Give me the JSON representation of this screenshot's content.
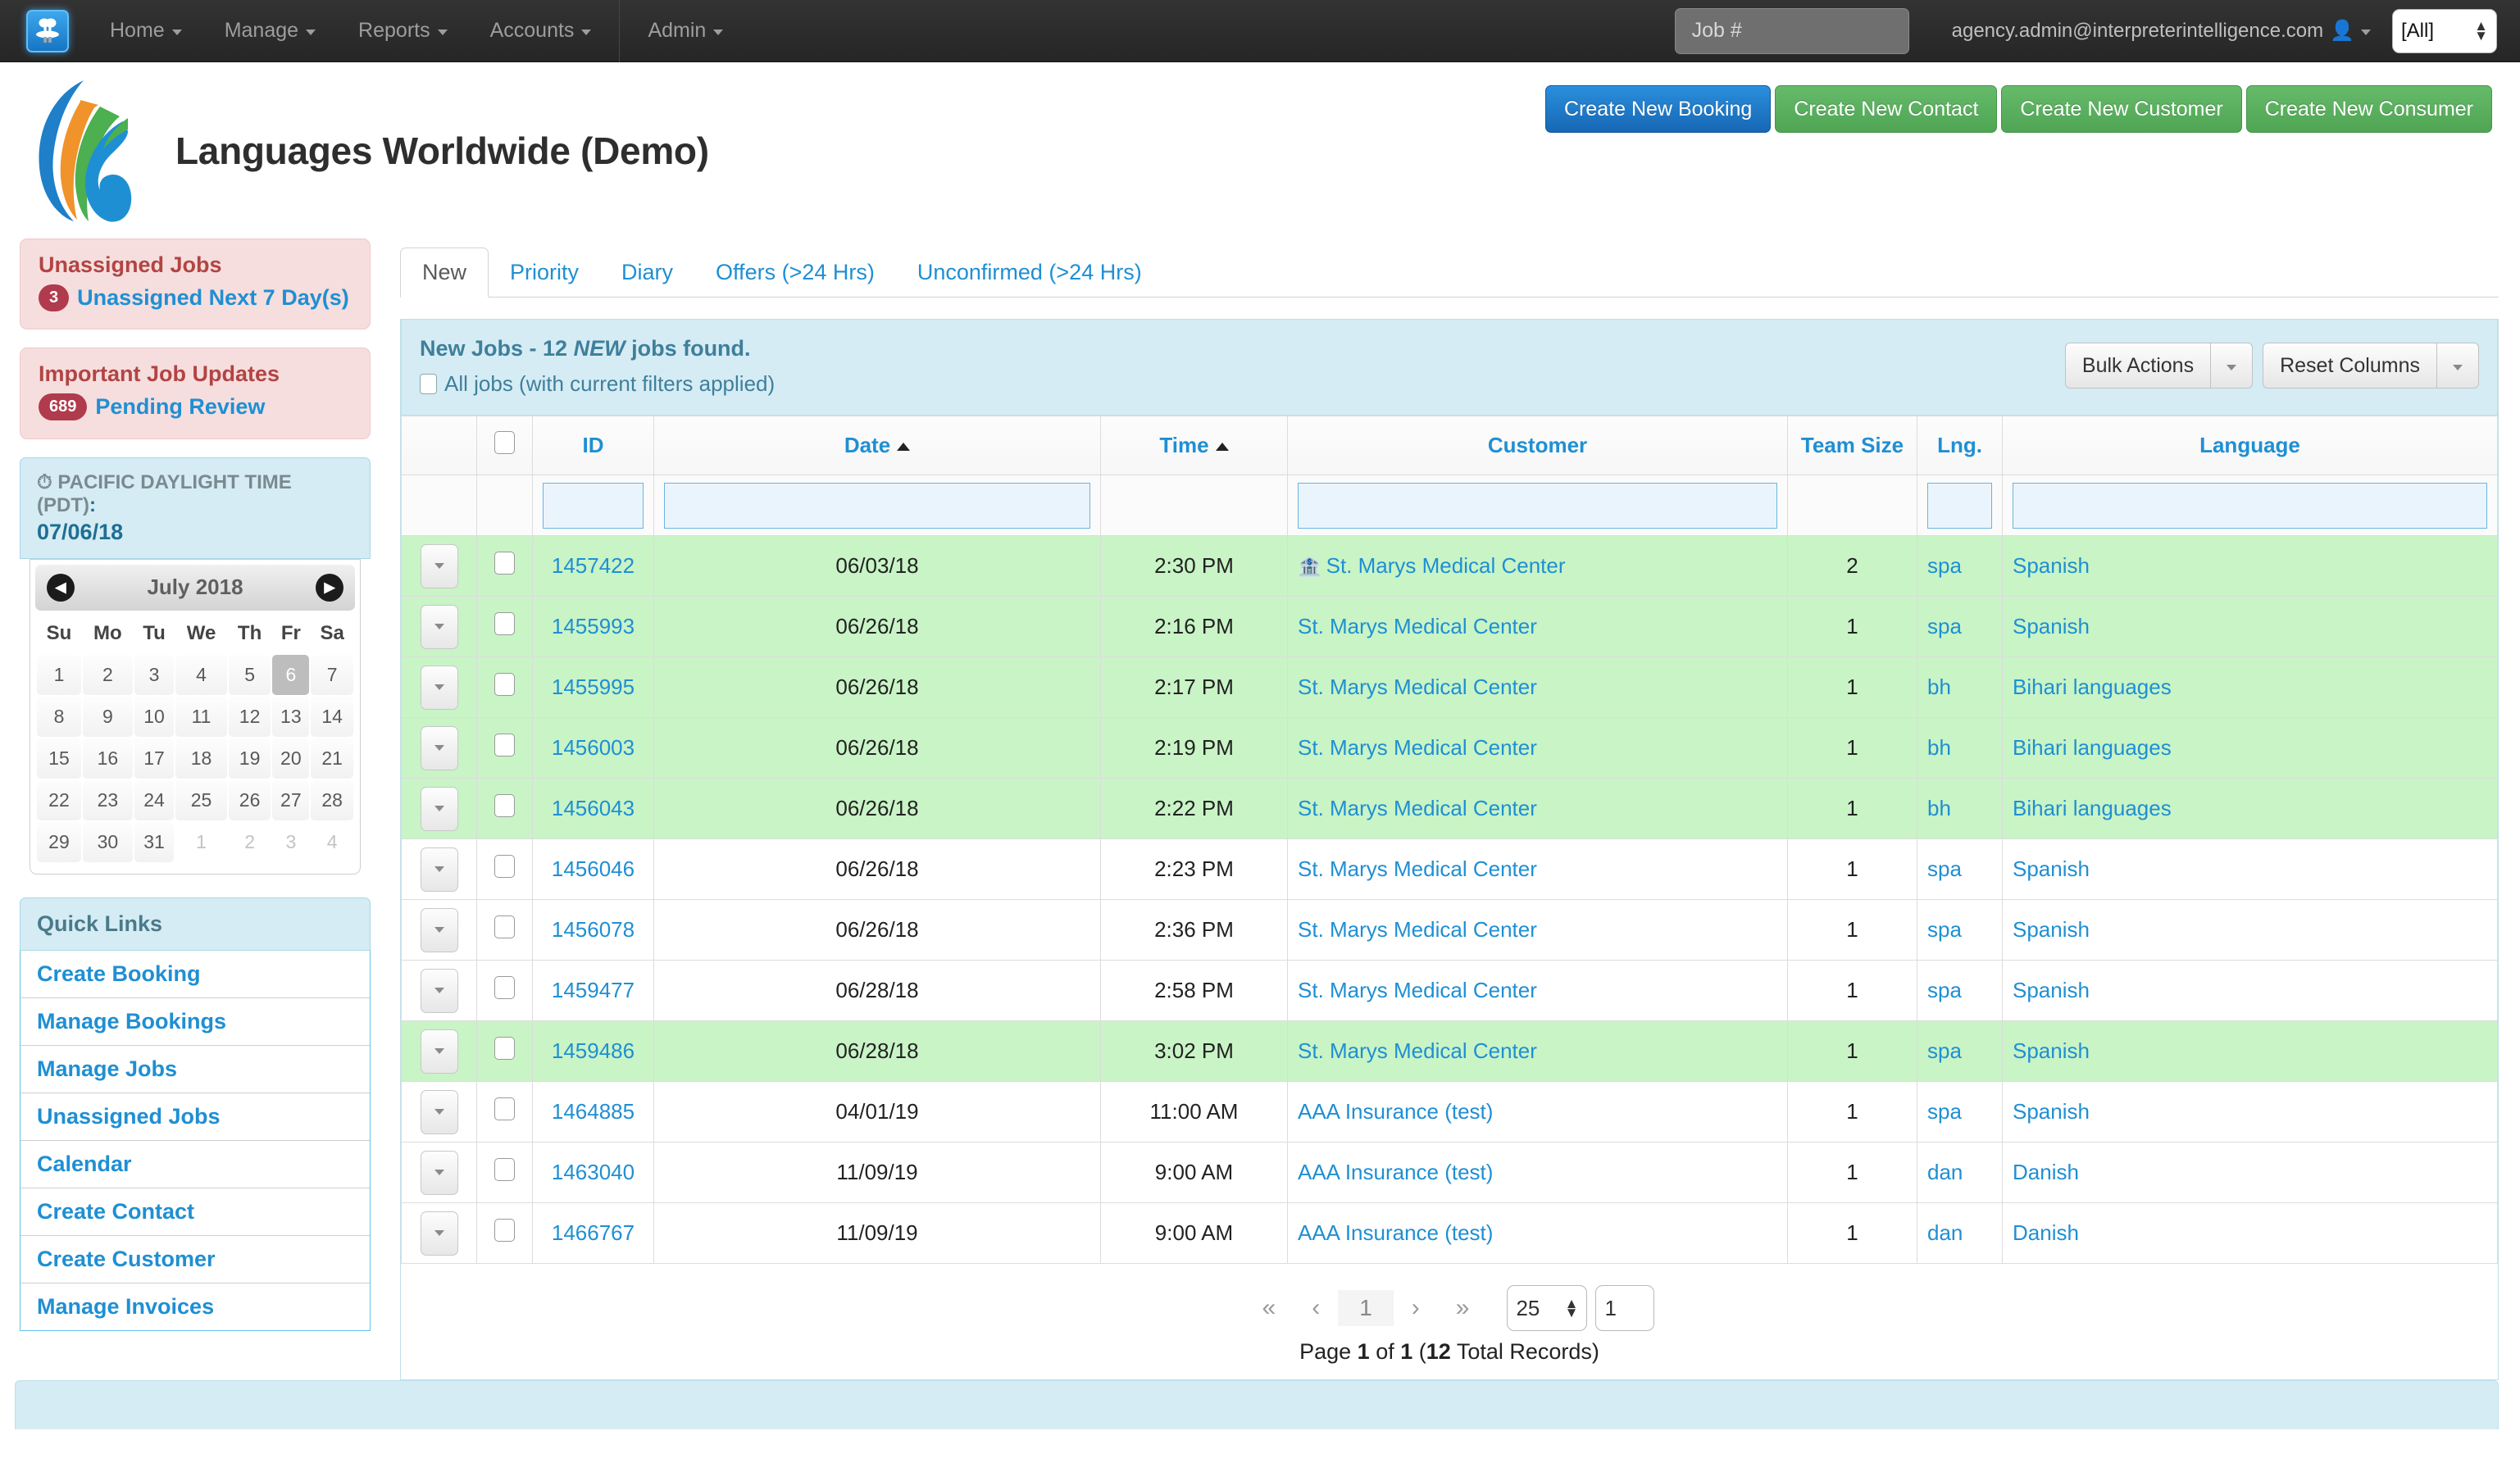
{
  "topnav": {
    "logo_icon": "app-logo-icon",
    "items": [
      {
        "label": "Home",
        "caret": true
      },
      {
        "label": "Manage",
        "caret": true
      },
      {
        "label": "Reports",
        "caret": true
      },
      {
        "label": "Accounts",
        "caret": true
      }
    ],
    "admin": {
      "label": "Admin",
      "caret": true
    },
    "job_search_placeholder": "Job #",
    "job_search_value": "",
    "user_email": "agency.admin@interpreterintelligence.com",
    "user_icon": "person-icon",
    "scope_select_value": "[All]"
  },
  "header": {
    "logo_icon": "company-swoosh-logo",
    "title": "Languages Worldwide (Demo)",
    "buttons": [
      {
        "label": "Create New Booking",
        "style": "blue"
      },
      {
        "label": "Create New Contact",
        "style": "green"
      },
      {
        "label": "Create New Customer",
        "style": "green"
      },
      {
        "label": "Create New Consumer",
        "style": "green"
      }
    ]
  },
  "sidebar": {
    "alerts": [
      {
        "title": "Unassigned Jobs",
        "badge": "3",
        "link": "Unassigned Next 7 Day(s)"
      },
      {
        "title": "Important Job Updates",
        "badge": "689",
        "link": "Pending Review"
      }
    ],
    "timezone": {
      "clock_icon": "clock-icon",
      "label": "PACIFIC DAYLIGHT TIME (PDT)",
      "date": "07/06/18"
    },
    "calendar": {
      "month_label": "July 2018",
      "prev_icon": "chevron-left-icon",
      "next_icon": "chevron-right-icon",
      "weekdays": [
        "Su",
        "Mo",
        "Tu",
        "We",
        "Th",
        "Fr",
        "Sa"
      ],
      "today": 6,
      "weeks": [
        [
          {
            "d": "1"
          },
          {
            "d": "2"
          },
          {
            "d": "3"
          },
          {
            "d": "4"
          },
          {
            "d": "5"
          },
          {
            "d": "6",
            "today": true
          },
          {
            "d": "7"
          }
        ],
        [
          {
            "d": "8"
          },
          {
            "d": "9"
          },
          {
            "d": "10"
          },
          {
            "d": "11"
          },
          {
            "d": "12"
          },
          {
            "d": "13"
          },
          {
            "d": "14"
          }
        ],
        [
          {
            "d": "15"
          },
          {
            "d": "16"
          },
          {
            "d": "17"
          },
          {
            "d": "18"
          },
          {
            "d": "19"
          },
          {
            "d": "20"
          },
          {
            "d": "21"
          }
        ],
        [
          {
            "d": "22"
          },
          {
            "d": "23"
          },
          {
            "d": "24"
          },
          {
            "d": "25"
          },
          {
            "d": "26"
          },
          {
            "d": "27"
          },
          {
            "d": "28"
          }
        ],
        [
          {
            "d": "29"
          },
          {
            "d": "30"
          },
          {
            "d": "31"
          },
          {
            "d": "1",
            "other": true
          },
          {
            "d": "2",
            "other": true
          },
          {
            "d": "3",
            "other": true
          },
          {
            "d": "4",
            "other": true
          }
        ]
      ]
    },
    "quick_links": {
      "title": "Quick Links",
      "items": [
        "Create Booking",
        "Manage Bookings",
        "Manage Jobs",
        "Unassigned Jobs",
        "Calendar",
        "Create Contact",
        "Create Customer",
        "Manage Invoices"
      ]
    }
  },
  "main": {
    "tabs": [
      {
        "label": "New",
        "active": true
      },
      {
        "label": "Priority",
        "active": false
      },
      {
        "label": "Diary",
        "active": false
      },
      {
        "label": "Offers (>24 Hrs)",
        "active": false
      },
      {
        "label": "Unconfirmed (>24 Hrs)",
        "active": false
      }
    ],
    "panel": {
      "title_pre": "New Jobs - 12 ",
      "title_em": "NEW",
      "title_post": " jobs found.",
      "all_jobs_label": "All jobs (with current filters applied)",
      "all_jobs_checked": false,
      "bulk_actions_label": "Bulk Actions",
      "reset_columns_label": "Reset Columns"
    },
    "table": {
      "columns": [
        {
          "key": "arrow",
          "label": ""
        },
        {
          "key": "check",
          "label": ""
        },
        {
          "key": "id",
          "label": "ID",
          "sort": ""
        },
        {
          "key": "date",
          "label": "Date",
          "sort": "asc"
        },
        {
          "key": "time",
          "label": "Time",
          "sort": "asc"
        },
        {
          "key": "customer",
          "label": "Customer",
          "sort": ""
        },
        {
          "key": "team_size",
          "label": "Team Size",
          "sort": ""
        },
        {
          "key": "lng",
          "label": "Lng.",
          "sort": ""
        },
        {
          "key": "language",
          "label": "Language",
          "sort": ""
        }
      ],
      "filter_values": {
        "id": "",
        "date": "",
        "time": "",
        "customer": "",
        "team_size": "",
        "lng": "",
        "language": ""
      },
      "rows": [
        {
          "id": "1457422",
          "date": "06/03/18",
          "time": "2:30 PM",
          "customer": "St. Marys Medical Center",
          "customer_icon": "building-icon",
          "team_size": "2",
          "lng": "spa",
          "language": "Spanish",
          "highlight": true
        },
        {
          "id": "1455993",
          "date": "06/26/18",
          "time": "2:16 PM",
          "customer": "St. Marys Medical Center",
          "customer_icon": "",
          "team_size": "1",
          "lng": "spa",
          "language": "Spanish",
          "highlight": true
        },
        {
          "id": "1455995",
          "date": "06/26/18",
          "time": "2:17 PM",
          "customer": "St. Marys Medical Center",
          "customer_icon": "",
          "team_size": "1",
          "lng": "bh",
          "language": "Bihari languages",
          "highlight": true
        },
        {
          "id": "1456003",
          "date": "06/26/18",
          "time": "2:19 PM",
          "customer": "St. Marys Medical Center",
          "customer_icon": "",
          "team_size": "1",
          "lng": "bh",
          "language": "Bihari languages",
          "highlight": true
        },
        {
          "id": "1456043",
          "date": "06/26/18",
          "time": "2:22 PM",
          "customer": "St. Marys Medical Center",
          "customer_icon": "",
          "team_size": "1",
          "lng": "bh",
          "language": "Bihari languages",
          "highlight": true
        },
        {
          "id": "1456046",
          "date": "06/26/18",
          "time": "2:23 PM",
          "customer": "St. Marys Medical Center",
          "customer_icon": "",
          "team_size": "1",
          "lng": "spa",
          "language": "Spanish",
          "highlight": false
        },
        {
          "id": "1456078",
          "date": "06/26/18",
          "time": "2:36 PM",
          "customer": "St. Marys Medical Center",
          "customer_icon": "",
          "team_size": "1",
          "lng": "spa",
          "language": "Spanish",
          "highlight": false
        },
        {
          "id": "1459477",
          "date": "06/28/18",
          "time": "2:58 PM",
          "customer": "St. Marys Medical Center",
          "customer_icon": "",
          "team_size": "1",
          "lng": "spa",
          "language": "Spanish",
          "highlight": false
        },
        {
          "id": "1459486",
          "date": "06/28/18",
          "time": "3:02 PM",
          "customer": "St. Marys Medical Center",
          "customer_icon": "",
          "team_size": "1",
          "lng": "spa",
          "language": "Spanish",
          "highlight": true
        },
        {
          "id": "1464885",
          "date": "04/01/19",
          "time": "11:00 AM",
          "customer": "AAA Insurance (test)",
          "customer_icon": "",
          "team_size": "1",
          "lng": "spa",
          "language": "Spanish",
          "highlight": false
        },
        {
          "id": "1463040",
          "date": "11/09/19",
          "time": "9:00 AM",
          "customer": "AAA Insurance (test)",
          "customer_icon": "",
          "team_size": "1",
          "lng": "dan",
          "language": "Danish",
          "highlight": false
        },
        {
          "id": "1466767",
          "date": "11/09/19",
          "time": "9:00 AM",
          "customer": "AAA Insurance (test)",
          "customer_icon": "",
          "team_size": "1",
          "lng": "dan",
          "language": "Danish",
          "highlight": false
        }
      ]
    },
    "pager": {
      "first_icon": "«",
      "prev_icon": "‹",
      "current_page": "1",
      "next_icon": "›",
      "last_icon": "»",
      "page_size": "25",
      "goto_page": "1",
      "summary_pre": "Page ",
      "summary_page": "1",
      "summary_mid": " of ",
      "summary_total_pages": "1",
      "summary_open": " (",
      "summary_records": "12",
      "summary_post": " Total Records)"
    }
  },
  "colors": {
    "accent_blue": "#1f8fd3",
    "primary_button": "#2a8fdd",
    "success_button": "#66bb6a",
    "alert_bg": "#f6dede",
    "alert_text": "#b24444",
    "info_bg": "#d5ecf4",
    "row_highlight": "#c9f4c6",
    "nav_bg": "#2b2b2b"
  }
}
